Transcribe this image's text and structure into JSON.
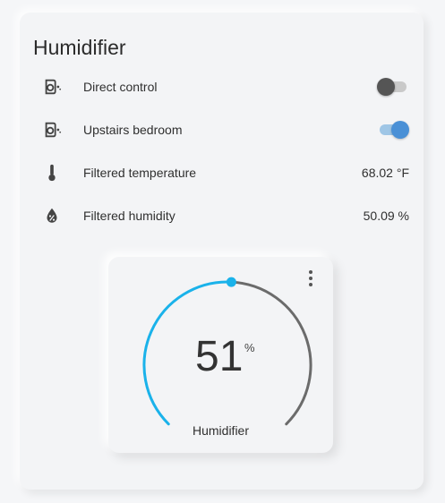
{
  "card": {
    "title": "Humidifier",
    "rows": [
      {
        "label": "Direct control",
        "icon": "air-humidifier-icon",
        "type": "toggle",
        "state": "off"
      },
      {
        "label": "Upstairs bedroom",
        "icon": "air-humidifier-icon",
        "type": "toggle",
        "state": "on"
      },
      {
        "label": "Filtered temperature",
        "icon": "thermometer-icon",
        "type": "value",
        "value": "68.02 °F"
      },
      {
        "label": "Filtered humidity",
        "icon": "water-percent-icon",
        "type": "value",
        "value": "50.09 %"
      }
    ]
  },
  "thermostat": {
    "value": "51",
    "unit": "%",
    "name": "Humidifier",
    "target_fraction": 0.51,
    "colors": {
      "active_arc": "#1ab2ea",
      "inactive_arc": "#6b6b6b"
    }
  },
  "colors": {
    "toggle_on": "#4a90d6",
    "toggle_off": "#555555"
  }
}
